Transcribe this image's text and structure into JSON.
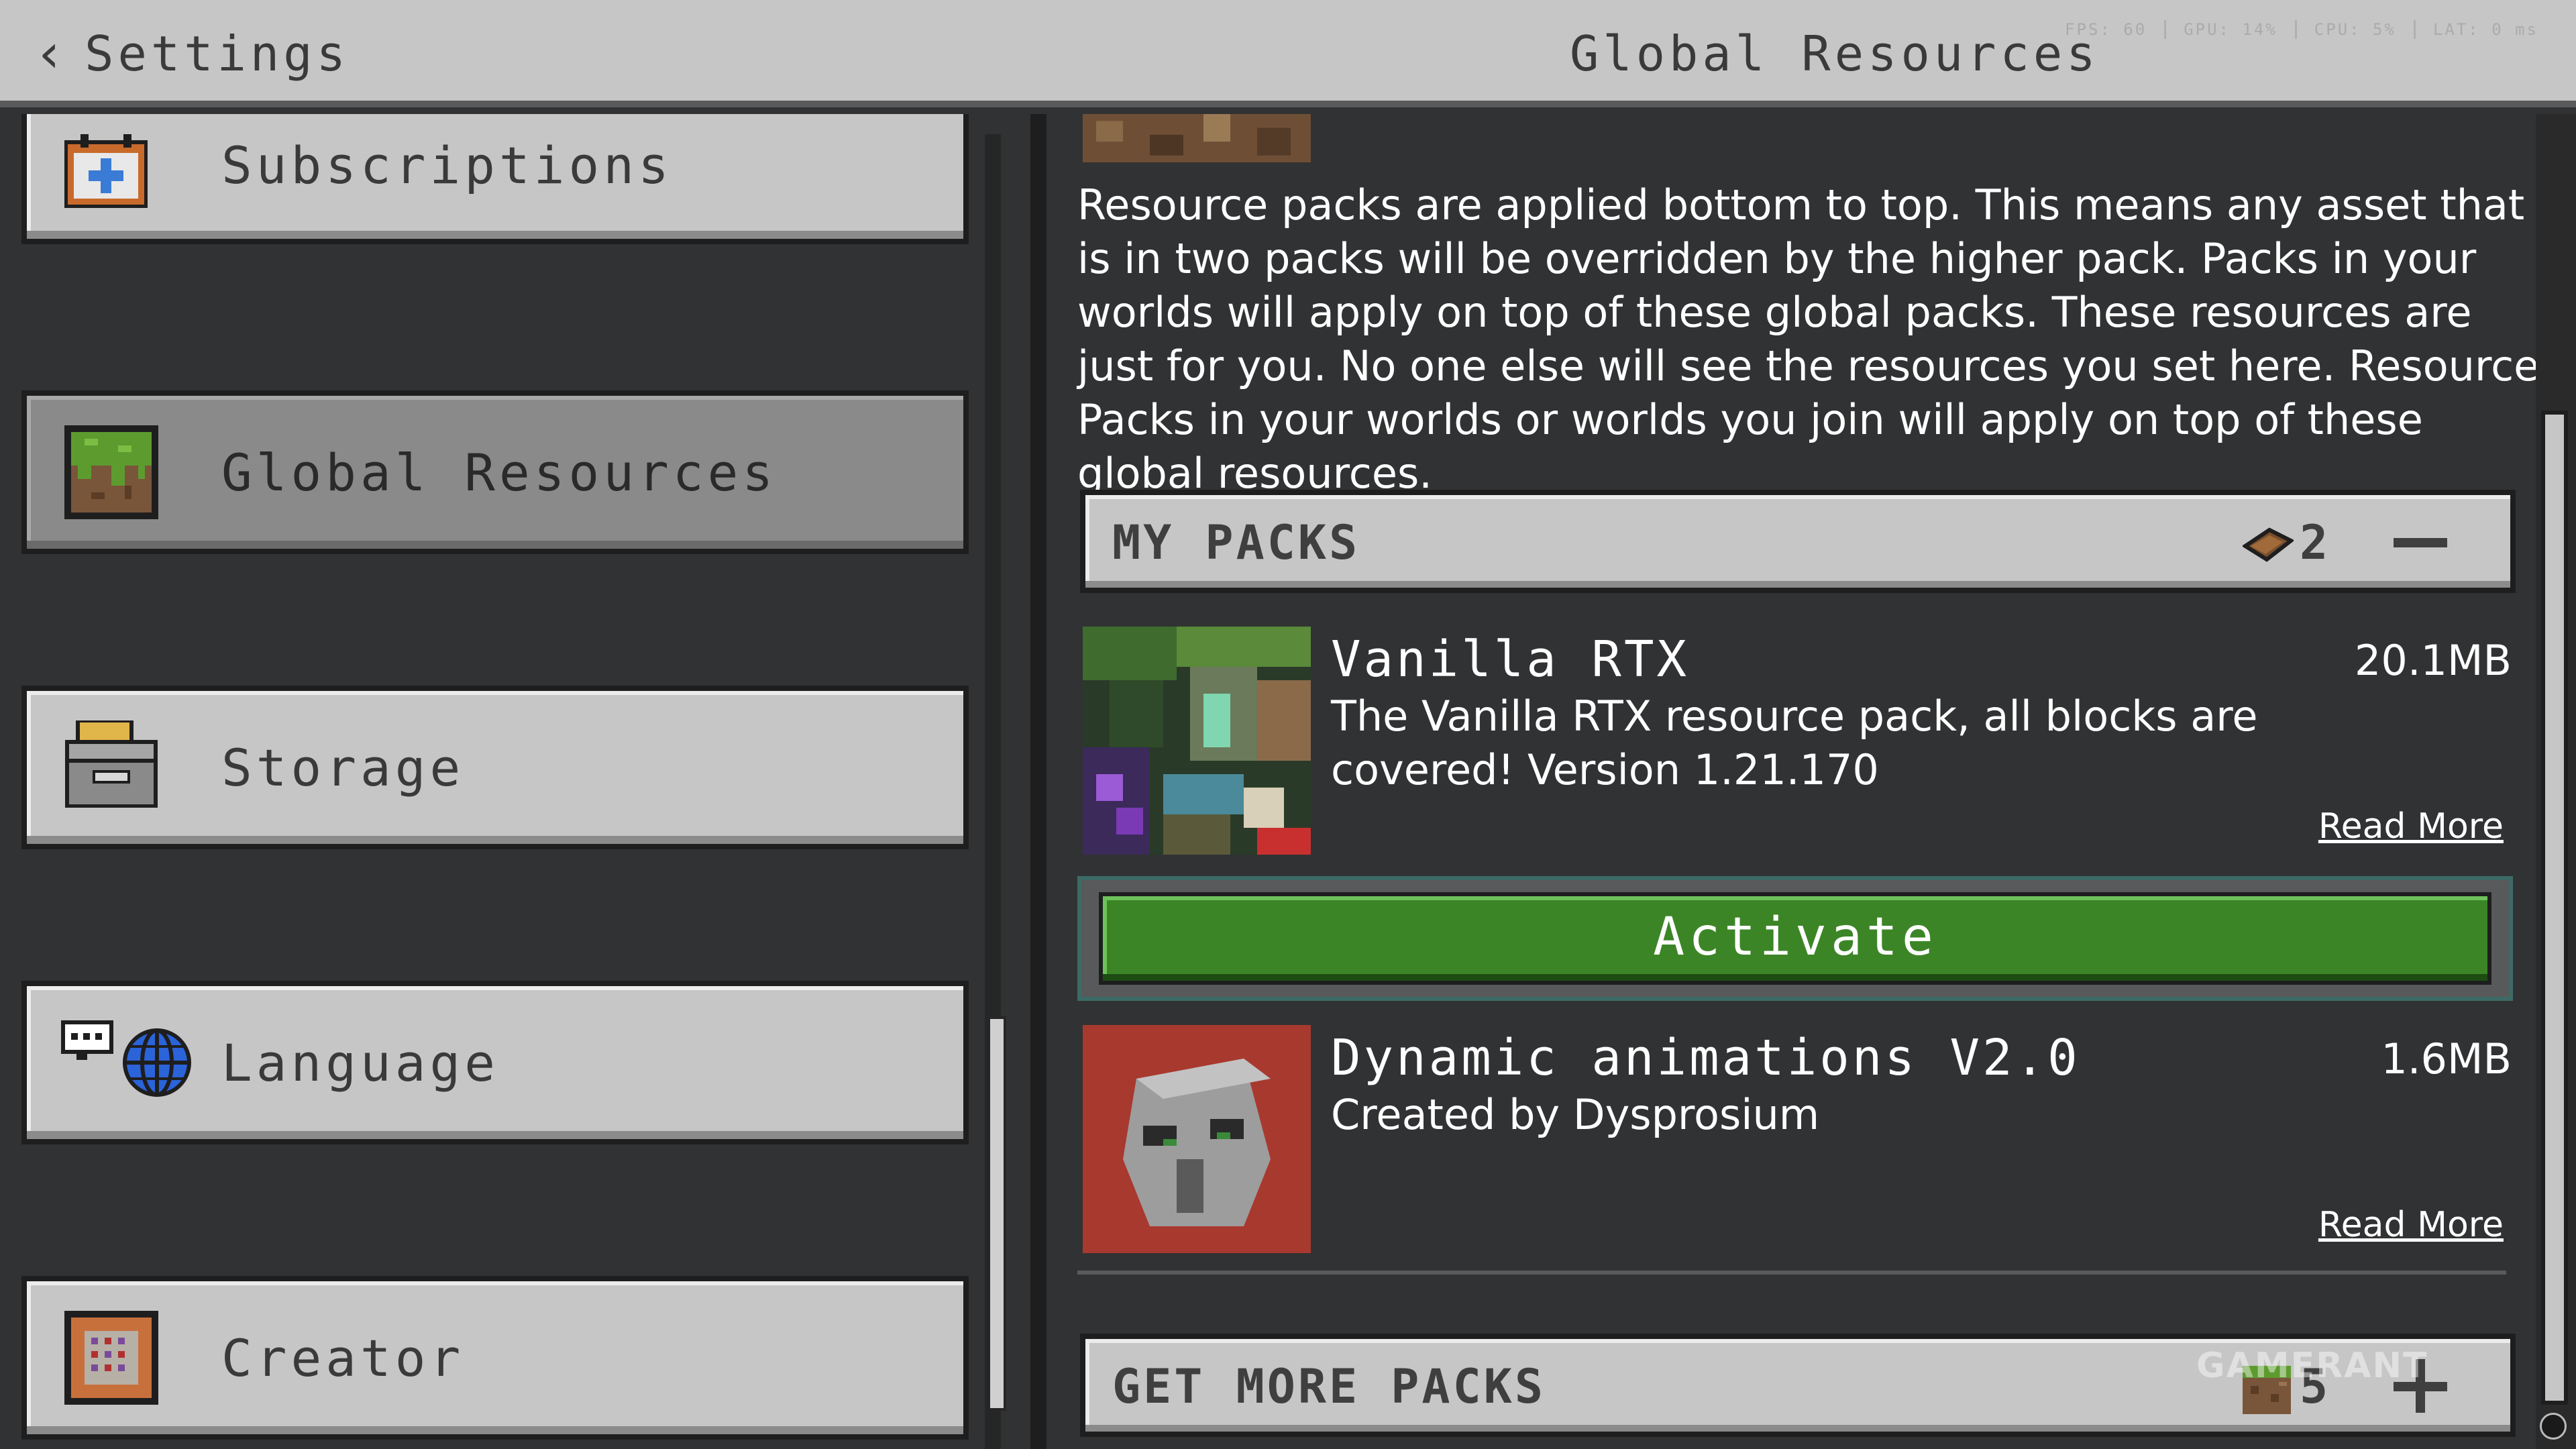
{
  "header": {
    "back_label": "Settings",
    "title": "Global Resources",
    "perf": [
      "FPS: 60",
      "GPU: 14%",
      "CPU: 5%",
      "LAT: 0 ms"
    ]
  },
  "sidebar": {
    "items": [
      {
        "label": "Subscriptions",
        "icon": "calendar-icon",
        "selected": false
      },
      {
        "label": "Global Resources",
        "icon": "grass-block-icon",
        "selected": true
      },
      {
        "label": "Storage",
        "icon": "storage-box-icon",
        "selected": false
      },
      {
        "label": "Language",
        "icon": "language-globe-icon",
        "selected": false
      },
      {
        "label": "Creator",
        "icon": "creator-icon",
        "selected": false
      }
    ]
  },
  "main": {
    "description": "Resource packs are applied bottom to top. This means any asset that is in two packs will be overridden by the higher pack. Packs in your worlds will apply on top of these global packs. These resources are just for you. No one else will see the resources you set here. Resource Packs in your worlds or worlds you join will apply on top of these global resources.",
    "my_packs": {
      "title": "MY PACKS",
      "count": "2",
      "icon": "book-icon",
      "toggle": "collapse-icon"
    },
    "packs": [
      {
        "name": "Vanilla RTX",
        "size": "20.1MB",
        "description": "The Vanilla RTX resource pack, all blocks are covered! Version 1.21.170",
        "read_more": "Read More"
      },
      {
        "name": "Dynamic animations V2.0",
        "size": "1.6MB",
        "description": "Created by Dysprosium",
        "read_more": "Read More"
      }
    ],
    "activate_label": "Activate",
    "get_more": {
      "title": "GET MORE PACKS",
      "count": "5",
      "icon": "dirt-block-icon",
      "toggle": "expand-icon"
    }
  },
  "watermark": "GAMERANT",
  "colors": {
    "accent_green": "#3c8527",
    "panel_gray": "#c6c6c6",
    "background": "#313233"
  }
}
